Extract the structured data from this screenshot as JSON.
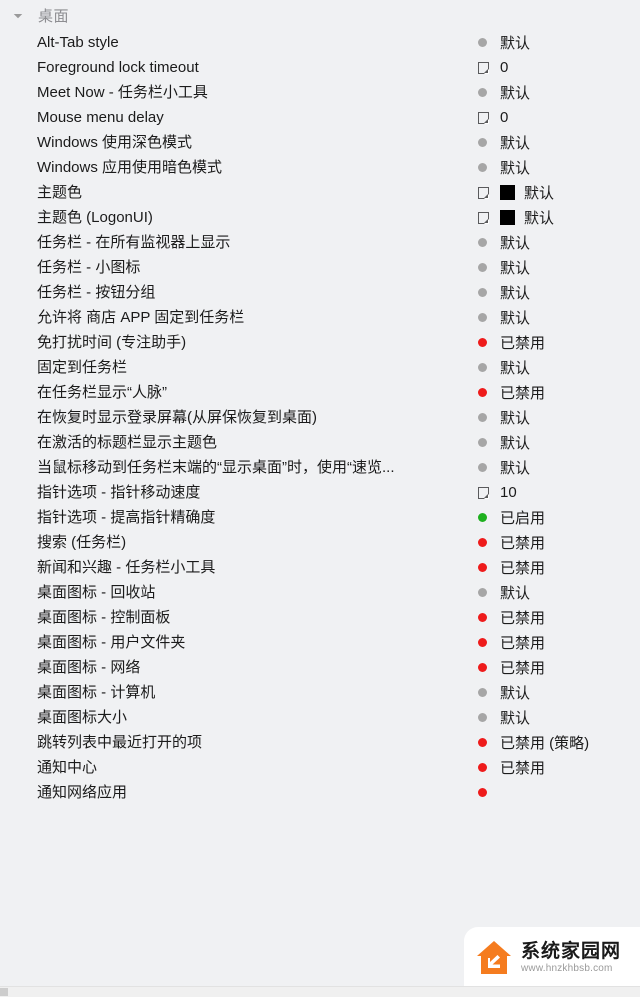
{
  "group": {
    "title": "桌面",
    "expander_icon": "triangle-collapse-icon"
  },
  "colors": {
    "background": "#f0f1f3",
    "default_dot": "#a6a6a6",
    "disabled_dot": "#ee1b1b",
    "enabled_dot": "#1eb01e",
    "swatch": "#000000",
    "text": "#1b1b1b",
    "group_title": "#8d8d91"
  },
  "rows": [
    {
      "label": "Alt-Tab style",
      "icon": "dot-default",
      "value": "默认"
    },
    {
      "label": "Foreground lock timeout",
      "icon": "page-value",
      "value": "0"
    },
    {
      "label": "Meet Now - 任务栏小工具",
      "icon": "dot-default",
      "value": "默认"
    },
    {
      "label": "Mouse menu delay",
      "icon": "page-value",
      "value": "0"
    },
    {
      "label": "Windows 使用深色模式",
      "icon": "dot-default",
      "value": "默认"
    },
    {
      "label": "Windows 应用使用暗色模式",
      "icon": "dot-default",
      "value": "默认"
    },
    {
      "label": "主题色",
      "icon": "page-value",
      "swatch": "#000000",
      "value": "默认"
    },
    {
      "label": "主题色 (LogonUI)",
      "icon": "page-value",
      "swatch": "#000000",
      "value": "默认"
    },
    {
      "label": "任务栏 - 在所有监视器上显示",
      "icon": "dot-default",
      "value": "默认"
    },
    {
      "label": "任务栏 - 小图标",
      "icon": "dot-default",
      "value": "默认"
    },
    {
      "label": "任务栏 - 按钮分组",
      "icon": "dot-default",
      "value": "默认"
    },
    {
      "label": "允许将 商店 APP 固定到任务栏",
      "icon": "dot-default",
      "value": "默认"
    },
    {
      "label": "免打扰时间 (专注助手)",
      "icon": "dot-disabled",
      "value": "已禁用"
    },
    {
      "label": "固定到任务栏",
      "icon": "dot-default",
      "value": "默认"
    },
    {
      "label": "在任务栏显示“人脉”",
      "icon": "dot-disabled",
      "value": "已禁用"
    },
    {
      "label": "在恢复时显示登录屏幕(从屏保恢复到桌面)",
      "icon": "dot-default",
      "value": "默认"
    },
    {
      "label": "在激活的标题栏显示主题色",
      "icon": "dot-default",
      "value": "默认"
    },
    {
      "label": "当鼠标移动到任务栏末端的“显示桌面”时，使用“速览...",
      "icon": "dot-default",
      "value": "默认"
    },
    {
      "label": "指针选项 - 指针移动速度",
      "icon": "page-value",
      "value": "10"
    },
    {
      "label": "指针选项 - 提高指针精确度",
      "icon": "dot-enabled",
      "value": "已启用"
    },
    {
      "label": "搜索 (任务栏)",
      "icon": "dot-disabled",
      "value": "已禁用"
    },
    {
      "label": "新闻和兴趣 - 任务栏小工具",
      "icon": "dot-disabled",
      "value": "已禁用"
    },
    {
      "label": "桌面图标 - 回收站",
      "icon": "dot-default",
      "value": "默认"
    },
    {
      "label": "桌面图标 - 控制面板",
      "icon": "dot-disabled",
      "value": "已禁用"
    },
    {
      "label": "桌面图标 - 用户文件夹",
      "icon": "dot-disabled",
      "value": "已禁用"
    },
    {
      "label": "桌面图标 - 网络",
      "icon": "dot-disabled",
      "value": "已禁用"
    },
    {
      "label": "桌面图标 - 计算机",
      "icon": "dot-default",
      "value": "默认"
    },
    {
      "label": "桌面图标大小",
      "icon": "dot-default",
      "value": "默认"
    },
    {
      "label": "跳转列表中最近打开的项",
      "icon": "dot-disabled",
      "value": "已禁用 (策略)"
    },
    {
      "label": "通知中心",
      "icon": "dot-disabled",
      "value": "已禁用"
    },
    {
      "label": "通知网络应用",
      "icon": "dot-disabled",
      "value": ""
    }
  ],
  "watermark": {
    "title": "系统家园网",
    "url": "www.hnzkhbsb.com",
    "logo_icon": "house-arrow-logo"
  }
}
